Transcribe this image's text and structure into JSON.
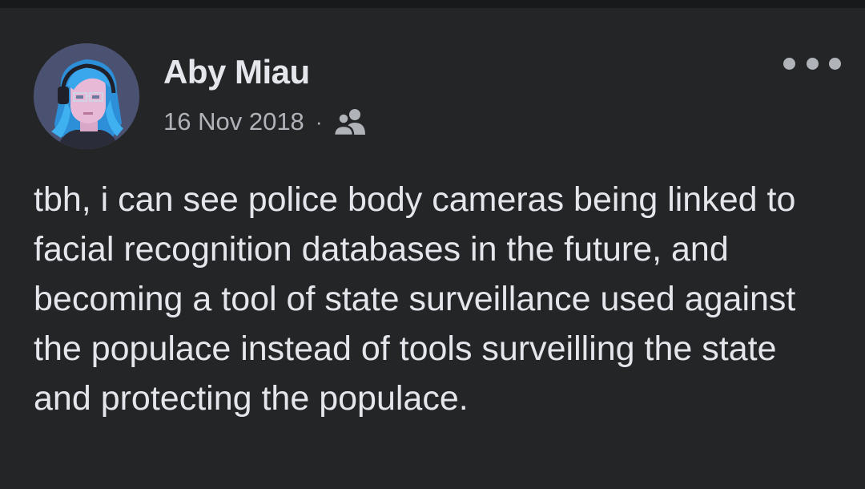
{
  "post": {
    "author": "Aby Miau",
    "date": "16 Nov 2018",
    "separator": "·",
    "audience_icon": "friends-icon",
    "more_icon": "more-options-icon",
    "text": "tbh, i can see police body cameras being linked to facial recognition databases in the future, and becoming a tool of state surveillance used against the populace instead of tools surveilling the state and protecting the populace."
  },
  "colors": {
    "background": "#242526",
    "top_bar": "#18191a",
    "primary_text": "#e4e6eb",
    "secondary_text": "#b0b3b8"
  }
}
